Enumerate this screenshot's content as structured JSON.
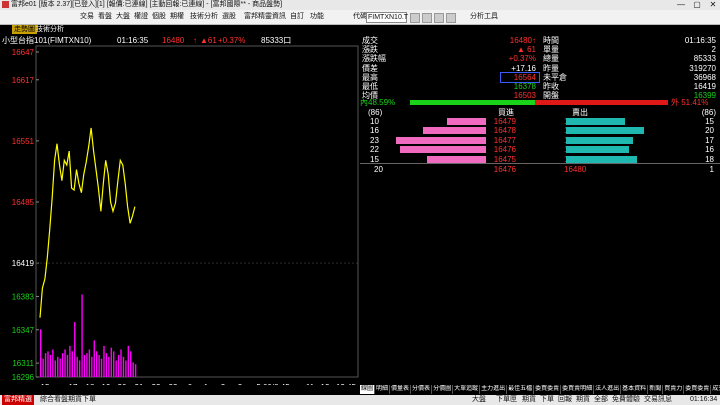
{
  "window": {
    "title": "富邦e01 [版本 2.37][已登入][1] [報價:已連線] [主動回報:已連線] - [富邦國際** - 商品盤勢]",
    "minimize": "—",
    "maximize": "▢",
    "close": "✕"
  },
  "menu": {
    "items": [
      "交易",
      "看盤",
      "大盤",
      "權證",
      "個股",
      "期權",
      "技術分析",
      "選股",
      "富邦精靈",
      "資訊",
      "自訂",
      "功能",
      "代碼"
    ],
    "symbol": "FIMTXN10.T",
    "analysis_tools": "分析工具"
  },
  "tabs": {
    "active": "走勢圖",
    "second": "技術分析"
  },
  "chart_header": {
    "name": "小型台指101(FIMTXN10)",
    "time": "01:16:35",
    "last": "16480",
    "arrow": "↑",
    "change": "▲61",
    "pct": "+0.37%",
    "volume": "85333",
    "volume_icon": "口"
  },
  "chart_data": {
    "type": "line",
    "title": "小型台指101(FIMTXN10)",
    "y_ticks": [
      16647,
      16617,
      16551,
      16485,
      16419,
      16383,
      16347,
      16311,
      16296
    ],
    "y_tick_colors": [
      "#ff3030",
      "#ff3030",
      "#ff3030",
      "#ff3030",
      "#ffffff",
      "#19d219",
      "#19d219",
      "#19d219",
      "#19d219"
    ],
    "reference_price": 16419,
    "ylim": [
      16296,
      16647
    ],
    "x_ticks": [
      "15",
      "17",
      "18",
      "19",
      "20",
      "21",
      "22",
      "23",
      "0",
      "1",
      "2",
      "3",
      "5:00/8:45",
      "11",
      "12",
      "13:45"
    ],
    "line_color": "#ffff00",
    "volume_color": "#ff00ff",
    "price_series": [
      {
        "t": 0,
        "v": 16360
      },
      {
        "t": 1,
        "v": 16392
      },
      {
        "t": 2,
        "v": 16402
      },
      {
        "t": 3,
        "v": 16425
      },
      {
        "t": 4,
        "v": 16455
      },
      {
        "t": 5,
        "v": 16490
      },
      {
        "t": 6,
        "v": 16530
      },
      {
        "t": 7,
        "v": 16548
      },
      {
        "t": 8,
        "v": 16525
      },
      {
        "t": 9,
        "v": 16508
      },
      {
        "t": 10,
        "v": 16530
      },
      {
        "t": 11,
        "v": 16525
      },
      {
        "t": 12,
        "v": 16540
      },
      {
        "t": 13,
        "v": 16500
      },
      {
        "t": 14,
        "v": 16498
      },
      {
        "t": 15,
        "v": 16520
      },
      {
        "t": 16,
        "v": 16505
      },
      {
        "t": 17,
        "v": 16495
      },
      {
        "t": 18,
        "v": 16515
      },
      {
        "t": 19,
        "v": 16528
      },
      {
        "t": 20,
        "v": 16545
      },
      {
        "t": 21,
        "v": 16565
      },
      {
        "t": 22,
        "v": 16540
      },
      {
        "t": 23,
        "v": 16520
      },
      {
        "t": 24,
        "v": 16500
      },
      {
        "t": 25,
        "v": 16475
      },
      {
        "t": 26,
        "v": 16505
      },
      {
        "t": 27,
        "v": 16530
      },
      {
        "t": 28,
        "v": 16515
      },
      {
        "t": 29,
        "v": 16485
      },
      {
        "t": 30,
        "v": 16475
      },
      {
        "t": 31,
        "v": 16484
      },
      {
        "t": 32,
        "v": 16508
      },
      {
        "t": 33,
        "v": 16530
      },
      {
        "t": 34,
        "v": 16525
      },
      {
        "t": 35,
        "v": 16505
      },
      {
        "t": 36,
        "v": 16480
      },
      {
        "t": 37,
        "v": 16462
      },
      {
        "t": 38,
        "v": 16470
      },
      {
        "t": 39,
        "v": 16480
      }
    ],
    "volume_series": [
      52,
      20,
      26,
      28,
      24,
      30,
      18,
      22,
      20,
      26,
      30,
      24,
      34,
      28,
      60,
      22,
      18,
      90,
      24,
      26,
      30,
      22,
      40,
      28,
      24,
      20,
      34,
      26,
      22,
      32,
      28,
      18,
      24,
      30,
      22,
      18,
      34,
      28,
      16,
      14
    ],
    "x_range_points": 130
  },
  "quote": {
    "rows_left": [
      {
        "label": "成交",
        "value": "16480↑",
        "color": "red"
      },
      {
        "label": "漲跌",
        "value": "▲ 61",
        "color": "red"
      },
      {
        "label": "漲跌幅",
        "value": "+0.37%",
        "color": "red"
      },
      {
        "label": "價差",
        "value": "+17.16",
        "color": "white"
      },
      {
        "label": "最高",
        "value": "16564",
        "color": "red"
      },
      {
        "label": "最低",
        "value": "16378",
        "color": "green"
      },
      {
        "label": "均價",
        "value": "16503",
        "color": "red"
      }
    ],
    "rows_right": [
      {
        "label": "時間",
        "value": "01:16:35",
        "color": "white"
      },
      {
        "label": "單量",
        "value": "2",
        "color": "white"
      },
      {
        "label": "總量",
        "value": "85333",
        "color": "white"
      },
      {
        "label": "昨量",
        "value": "319270",
        "color": "white"
      },
      {
        "label": "未平倉",
        "value": "36968",
        "color": "white"
      },
      {
        "label": "昨收",
        "value": "16419",
        "color": "white"
      },
      {
        "label": "開盤",
        "value": "16399",
        "color": "green"
      }
    ],
    "inner_label": "內",
    "inner_pct": "48.59%",
    "outer_label": "外",
    "outer_pct": "51.41%",
    "inner_ratio": 0.4859,
    "bid_count": "(86)",
    "ask_count": "(86)",
    "bid_header": "買進",
    "ask_header": "賣出",
    "book": [
      {
        "bid_qty": "10",
        "bid_price": "16479",
        "ask_price": "16480",
        "ask_qty": "15",
        "bid_level": 10,
        "ask_level": 15
      },
      {
        "bid_qty": "16",
        "bid_price": "16478",
        "ask_price": "16481",
        "ask_qty": "20",
        "bid_level": 16,
        "ask_level": 20
      },
      {
        "bid_qty": "23",
        "bid_price": "16477",
        "ask_price": "16482",
        "ask_qty": "17",
        "bid_level": 23,
        "ask_level": 17
      },
      {
        "bid_qty": "22",
        "bid_price": "16476",
        "ask_price": "16483",
        "ask_qty": "16",
        "bid_level": 22,
        "ask_level": 16
      },
      {
        "bid_qty": "15",
        "bid_price": "16475",
        "ask_price": "16484",
        "ask_qty": "18",
        "bid_level": 15,
        "ask_level": 18
      }
    ],
    "last_trade": {
      "qty": "20",
      "bid": "16476",
      "ask": "16480",
      "vol": "1"
    }
  },
  "bottom_tabs": [
    "線圖",
    "明細",
    "價量表",
    "分價表",
    "分價圖",
    "大單追蹤",
    "主力進出",
    "最佳五檔",
    "委買委賣",
    "委買賣明細",
    "法人進出",
    "基本資料",
    "新聞",
    "買賣力",
    "委買委賣",
    "成交價"
  ],
  "statusbar": {
    "items": [
      "富邦精選",
      "綜合看盤",
      "期貨下單"
    ],
    "right_items": [
      "大盤",
      "下單匣",
      "期貨",
      "下單",
      "回報",
      "期貨",
      "全部",
      "免費體驗",
      "交易訊息"
    ],
    "clock": "01:16:34"
  }
}
